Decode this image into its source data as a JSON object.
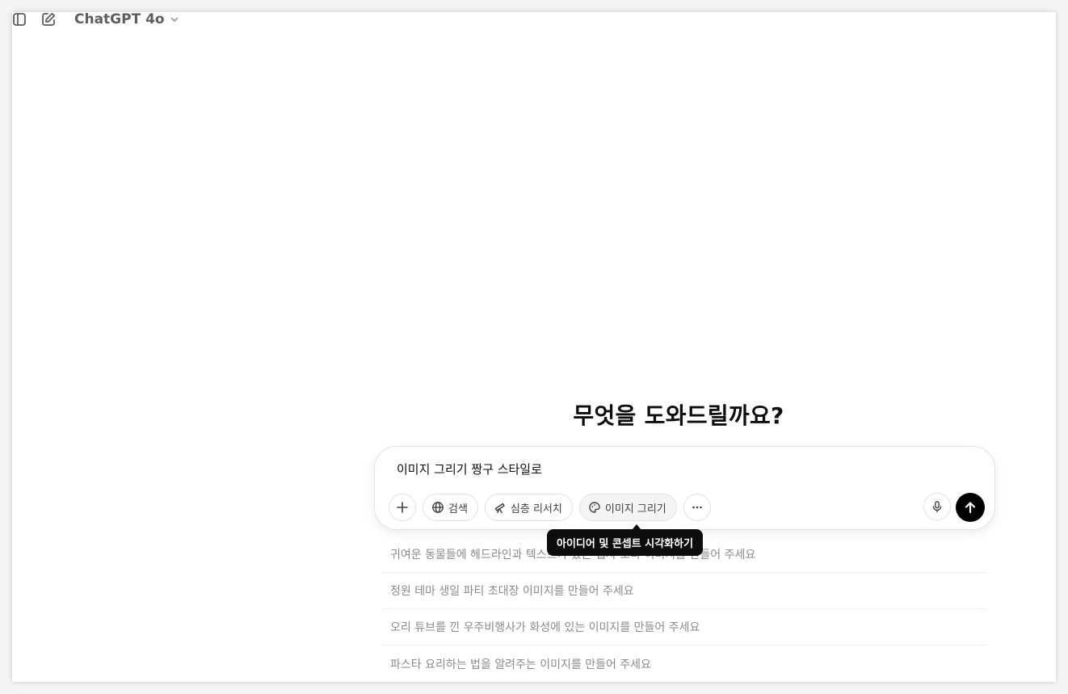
{
  "header": {
    "model_name": "ChatGPT 4o"
  },
  "main": {
    "headline": "무엇을 도와드릴까요?"
  },
  "composer": {
    "input_text": "이미지 그리기 짱구 스타일로",
    "tools": {
      "search_label": "검색",
      "deep_research_label": "심층 리서치",
      "image_label": "이미지 그리기"
    },
    "tooltip": "아이디어 및 콘셉트 시각화하기"
  },
  "suggestions": [
    "귀여운 동물들에 헤드라인과 텍스트가 있는 웹사 보다 이미지를 만들어 주세요",
    "정원 테마 생일 파티 초대장 이미지를 만들어 주세요",
    "오리 튜브를 낀 우주비행사가 화성에 있는 이미지를 만들어 주세요",
    "파스타 요리하는 법을 알려주는 이미지를 만들어 주세요"
  ],
  "colors": {
    "send_button": "#000000",
    "tooltip_bg": "#0d0d0d",
    "muted_text": "#8a8a8a"
  }
}
